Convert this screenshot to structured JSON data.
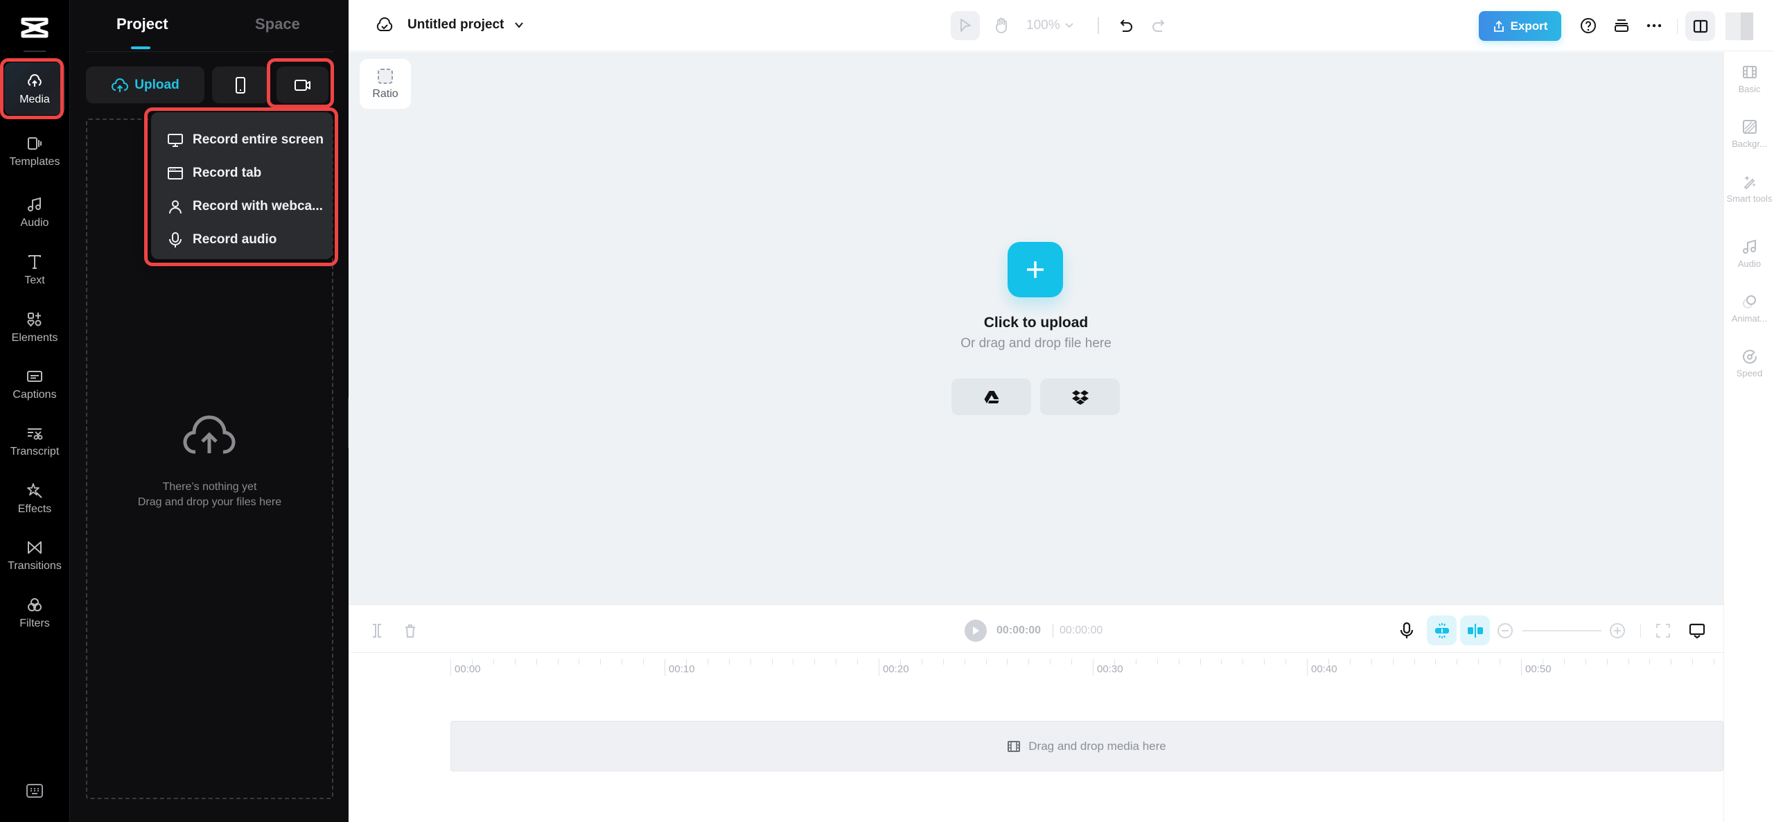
{
  "rail": {
    "items": [
      {
        "label": "Media",
        "icon": "cloud-upload-icon",
        "active": true
      },
      {
        "label": "Templates",
        "icon": "templates-icon"
      },
      {
        "label": "Audio",
        "icon": "music-note-icon"
      },
      {
        "label": "Text",
        "icon": "text-icon"
      },
      {
        "label": "Elements",
        "icon": "elements-icon"
      },
      {
        "label": "Captions",
        "icon": "captions-icon"
      },
      {
        "label": "Transcript",
        "icon": "transcript-icon"
      },
      {
        "label": "Effects",
        "icon": "effects-icon"
      },
      {
        "label": "Transitions",
        "icon": "transitions-icon"
      },
      {
        "label": "Filters",
        "icon": "filters-icon"
      }
    ]
  },
  "panel": {
    "tabs": [
      {
        "label": "Project",
        "active": true
      },
      {
        "label": "Space"
      }
    ],
    "upload_label": "Upload",
    "empty_line1": "There’s nothing yet",
    "empty_line2": "Drag and drop your files here",
    "record_menu": [
      {
        "label": "Record entire screen",
        "icon": "monitor-icon"
      },
      {
        "label": "Record tab",
        "icon": "browser-tab-icon"
      },
      {
        "label": "Record with webca...",
        "icon": "person-icon"
      },
      {
        "label": "Record audio",
        "icon": "microphone-icon"
      }
    ]
  },
  "topbar": {
    "project_title": "Untitled project",
    "zoom_level": "100%",
    "export_label": "Export"
  },
  "canvas": {
    "ratio_label": "Ratio",
    "upload_title": "Click to upload",
    "upload_hint": "Or drag and drop file here"
  },
  "right_panel": {
    "items": [
      {
        "label": "Basic",
        "icon": "film-icon"
      },
      {
        "label": "Backgr...",
        "icon": "background-icon"
      },
      {
        "label": "Smart tools",
        "icon": "magic-wand-icon"
      },
      {
        "label": "Audio",
        "icon": "music-note-icon"
      },
      {
        "label": "Animat...",
        "icon": "animation-icon"
      },
      {
        "label": "Speed",
        "icon": "speed-icon"
      }
    ]
  },
  "timeline": {
    "current_time": "00:00:00",
    "total_time": "00:00:00",
    "ruler_labels": [
      "00:00",
      "00:10",
      "00:20",
      "00:30",
      "00:40",
      "00:50"
    ],
    "track_hint": "Drag and drop media here"
  },
  "colors": {
    "accent": "#13c1e9",
    "export_gradient_start": "#3d8ee6",
    "export_gradient_end": "#2bb6e4",
    "highlight": "#ef4444"
  }
}
